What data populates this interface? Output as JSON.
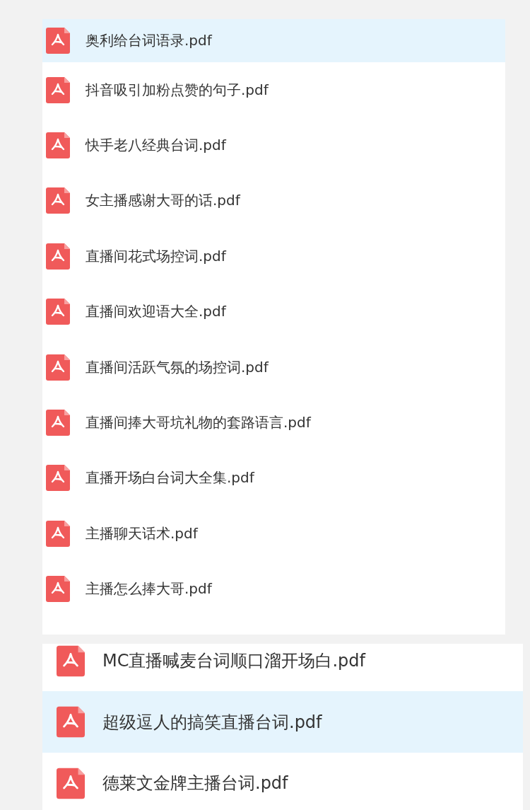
{
  "lists": [
    {
      "kind": "small",
      "files": [
        {
          "name": "奥利给台词语录.pdf",
          "selected": true
        },
        {
          "name": "抖音吸引加粉点赞的句子.pdf",
          "selected": false
        },
        {
          "name": "快手老八经典台词.pdf",
          "selected": false
        },
        {
          "name": "女主播感谢大哥的话.pdf",
          "selected": false
        },
        {
          "name": "直播间花式场控词.pdf",
          "selected": false
        },
        {
          "name": "直播间欢迎语大全.pdf",
          "selected": false
        },
        {
          "name": "直播间活跃气氛的场控词.pdf",
          "selected": false
        },
        {
          "name": "直播间捧大哥坑礼物的套路语言.pdf",
          "selected": false
        },
        {
          "name": "直播开场白台词大全集.pdf",
          "selected": false
        },
        {
          "name": "主播聊天话术.pdf",
          "selected": false
        },
        {
          "name": "主播怎么捧大哥.pdf",
          "selected": false
        }
      ]
    },
    {
      "kind": "large",
      "files": [
        {
          "name": "MC直播喊麦台词顺口溜开场白.pdf",
          "selected": false
        },
        {
          "name": "超级逗人的搞笑直播台词.pdf",
          "selected": true
        },
        {
          "name": "德莱文金牌主播台词.pdf",
          "selected": false
        }
      ]
    }
  ]
}
